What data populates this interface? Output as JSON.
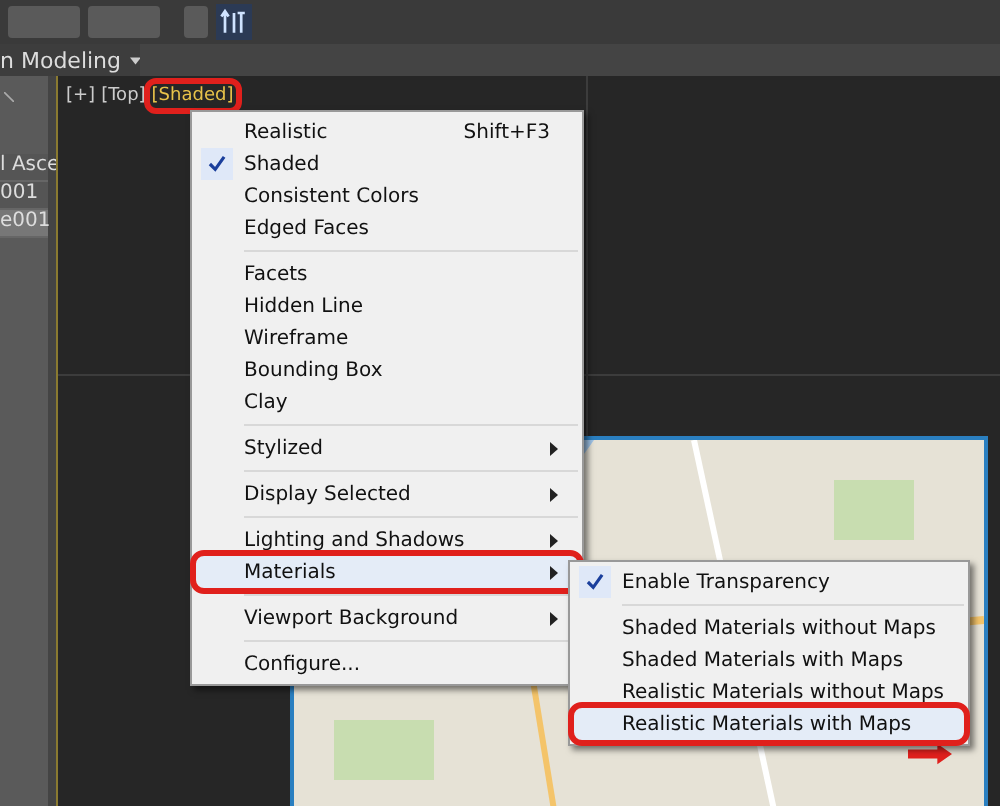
{
  "toolbar": {
    "ribbon_label": "n Modeling"
  },
  "scene_list": [
    {
      "label": "l Asce",
      "selected": false
    },
    {
      "label": "001",
      "selected": false
    },
    {
      "label": "e001",
      "selected": true
    }
  ],
  "viewport": {
    "labels": [
      {
        "text": "[+]",
        "marked": false
      },
      {
        "text": "[Top]",
        "marked": false
      },
      {
        "text": "[Shaded]",
        "marked": true
      }
    ]
  },
  "menu": {
    "items": [
      {
        "kind": "item",
        "label": "Realistic",
        "shortcut": "Shift+F3",
        "checked": false,
        "submenu": false,
        "marked": false
      },
      {
        "kind": "item",
        "label": "Shaded",
        "checked": true,
        "submenu": false,
        "marked": false
      },
      {
        "kind": "item",
        "label": "Consistent Colors",
        "checked": false,
        "submenu": false,
        "marked": false
      },
      {
        "kind": "item",
        "label": "Edged Faces",
        "checked": false,
        "submenu": false,
        "marked": false
      },
      {
        "kind": "separator"
      },
      {
        "kind": "item",
        "label": "Facets",
        "checked": false,
        "submenu": false,
        "marked": false
      },
      {
        "kind": "item",
        "label": "Hidden Line",
        "checked": false,
        "submenu": false,
        "marked": false
      },
      {
        "kind": "item",
        "label": "Wireframe",
        "checked": false,
        "submenu": false,
        "marked": false
      },
      {
        "kind": "item",
        "label": "Bounding Box",
        "checked": false,
        "submenu": false,
        "marked": false
      },
      {
        "kind": "item",
        "label": "Clay",
        "checked": false,
        "submenu": false,
        "marked": false
      },
      {
        "kind": "separator"
      },
      {
        "kind": "item",
        "label": "Stylized",
        "checked": false,
        "submenu": true,
        "marked": false
      },
      {
        "kind": "separator"
      },
      {
        "kind": "item",
        "label": "Display Selected",
        "checked": false,
        "submenu": true,
        "marked": false
      },
      {
        "kind": "separator"
      },
      {
        "kind": "item",
        "label": "Lighting and Shadows",
        "checked": false,
        "submenu": true,
        "marked": false
      },
      {
        "kind": "item",
        "label": "Materials",
        "checked": false,
        "submenu": true,
        "marked": true
      },
      {
        "kind": "separator"
      },
      {
        "kind": "item",
        "label": "Viewport Background",
        "checked": false,
        "submenu": true,
        "marked": false
      },
      {
        "kind": "separator"
      },
      {
        "kind": "item",
        "label": "Configure...",
        "checked": false,
        "submenu": false,
        "marked": false
      }
    ]
  },
  "submenu": {
    "items": [
      {
        "kind": "item",
        "label": "Enable Transparency",
        "checked": true,
        "marked": false
      },
      {
        "kind": "separator"
      },
      {
        "kind": "item",
        "label": "Shaded Materials without Maps",
        "checked": false,
        "marked": false
      },
      {
        "kind": "item",
        "label": "Shaded Materials with Maps",
        "checked": false,
        "marked": false
      },
      {
        "kind": "item",
        "label": "Realistic Materials without Maps",
        "checked": false,
        "marked": false
      },
      {
        "kind": "item",
        "label": "Realistic Materials with Maps",
        "checked": false,
        "marked": true
      }
    ]
  }
}
